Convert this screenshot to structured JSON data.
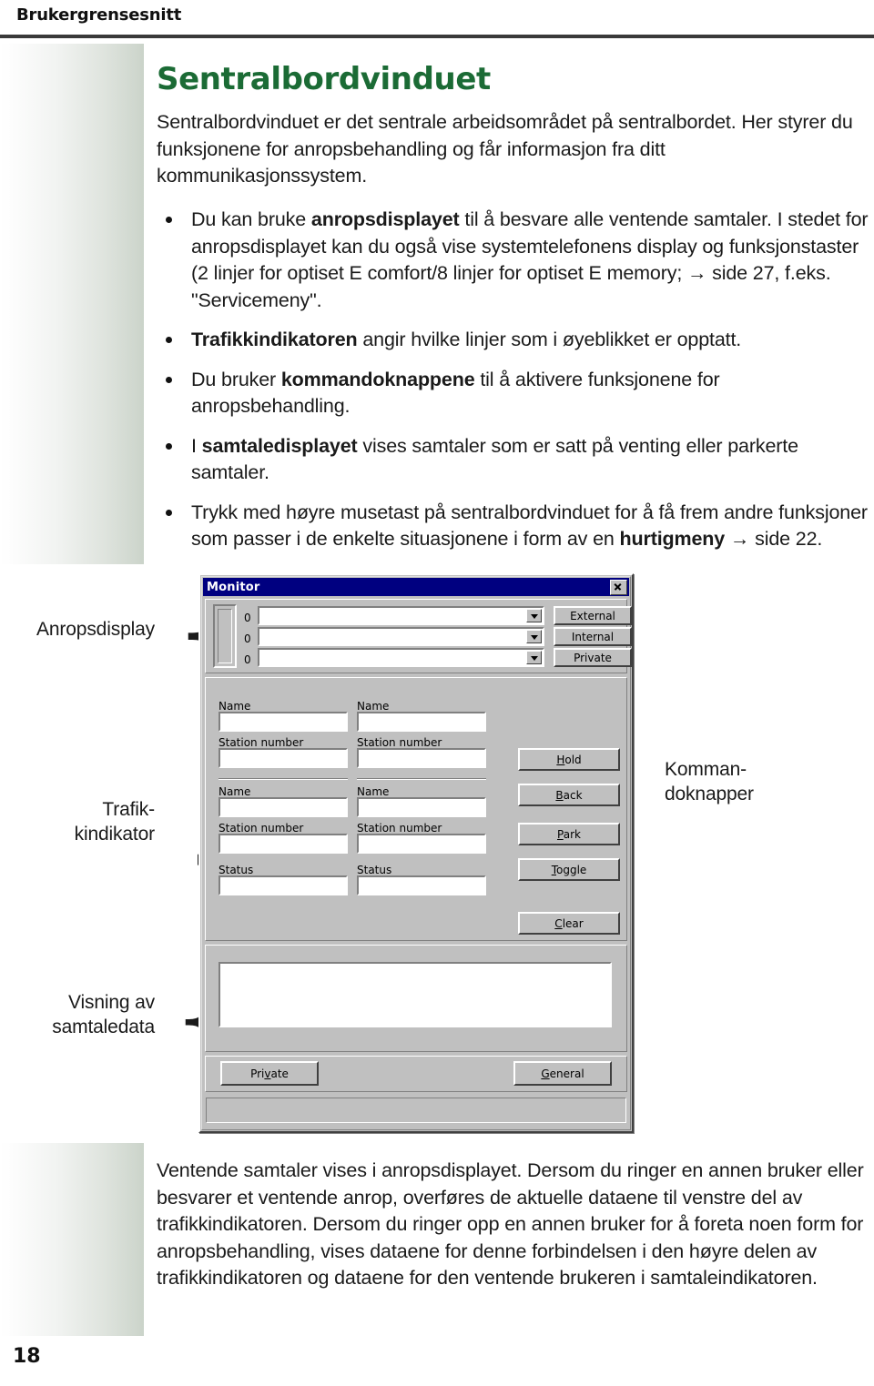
{
  "header": {
    "running_title": "Brukergrensesnitt"
  },
  "page": {
    "number": "18",
    "title": "Sentralbordvinduet",
    "intro": "Sentralbordvinduet er det sentrale arbeidsområdet på sentralbordet. Her styrer du funksjonene for anropsbehandling og får informasjon fra ditt kommunikasjonssystem.",
    "bullets": [
      {
        "segments": [
          {
            "text": "Du kan bruke ",
            "bold": false
          },
          {
            "text": "anropsdisplayet",
            "bold": true
          },
          {
            "text": " til å besvare alle ventende samtaler. I stedet for anropsdisplayet kan du også vise systemtelefonens display og funksjonstaster (2 linjer for optiset E comfort/8 linjer for optiset E memory; → side 27, f.eks. \"Servicemeny\".",
            "bold": false
          }
        ]
      },
      {
        "segments": [
          {
            "text": "Trafikkindikatoren",
            "bold": true
          },
          {
            "text": " angir hvilke linjer som i øyeblikket er opptatt.",
            "bold": false
          }
        ]
      },
      {
        "segments": [
          {
            "text": "Du bruker ",
            "bold": false
          },
          {
            "text": "kommandoknappene",
            "bold": true
          },
          {
            "text": " til å aktivere funksjonene for anropsbehandling.",
            "bold": false
          }
        ]
      },
      {
        "segments": [
          {
            "text": "I ",
            "bold": false
          },
          {
            "text": "samtaledisplayet",
            "bold": true
          },
          {
            "text": " vises samtaler som er satt på venting eller parkerte samtaler.",
            "bold": false
          }
        ]
      },
      {
        "segments": [
          {
            "text": "Trykk med høyre musetast på sentralbordvinduet for å få frem andre funksjoner som passer i de enkelte situasjonene i form av en ",
            "bold": false
          },
          {
            "text": "hurtigmeny",
            "bold": true
          },
          {
            "text": " → side 22.",
            "bold": false
          }
        ]
      }
    ],
    "closing": "Ventende samtaler vises i anropsdisplayet. Dersom du ringer en annen bruker eller besvarer et ventende anrop, overføres de aktuelle dataene til venstre del av trafikkindikatoren. Dersom du ringer opp en annen bruker for å foreta noen form for anropsbehandling, vises dataene for denne forbindelsen i den høyre delen av trafikkindikatoren og dataene for den ventende brukeren i samtaleindikatoren."
  },
  "annotations": {
    "anropsdisplay": "Anropsdisplay",
    "trafikkindikator_line1": "Trafik-",
    "trafikkindikator_line2": "kindikator",
    "kommandoknapper_line1": "Komman-",
    "kommandoknapper_line2": "doknapper",
    "samtaledata_line1": "Visning av",
    "samtaledata_line2": "samtaledata",
    "brace_glyph": "{",
    "brace_glyph_right": "}"
  },
  "dialog": {
    "title": "Monitor",
    "close_label": "×",
    "call_display": {
      "rows": [
        {
          "count": "0",
          "value": "",
          "button": "External"
        },
        {
          "count": "0",
          "value": "",
          "button": "Internal"
        },
        {
          "count": "0",
          "value": "",
          "button": "Private"
        }
      ]
    },
    "traffic_indicator": {
      "left_column": {
        "name_label_1": "Name",
        "name_value_1": "",
        "station_label_1": "Station number",
        "station_value_1": "",
        "name_label_2": "Name",
        "name_value_2": "",
        "station_label_2": "Station number",
        "station_value_2": "",
        "status_label": "Status",
        "status_value": ""
      },
      "right_column": {
        "name_label_1": "Name",
        "name_value_1": "",
        "station_label_1": "Station number",
        "station_value_1": "",
        "name_label_2": "Name",
        "name_value_2": "",
        "station_label_2": "Station number",
        "station_value_2": "",
        "status_label": "Status",
        "status_value": ""
      }
    },
    "command_buttons": [
      {
        "label": "Hold",
        "mnemonic": "H",
        "rest": "old"
      },
      {
        "label": "Back",
        "mnemonic": "B",
        "rest": "ack"
      },
      {
        "label": "Park",
        "mnemonic": "P",
        "rest": "ark"
      },
      {
        "label": "Toggle",
        "mnemonic": "T",
        "rest": "oggle"
      },
      {
        "label": "Clear",
        "mnemonic": "C",
        "rest": "lear"
      }
    ],
    "call_data_value": "",
    "footer_buttons": [
      {
        "label": "Private",
        "pre": "Pri",
        "mnemonic": "v",
        "rest": "ate"
      },
      {
        "label": "General",
        "mnemonic": "G",
        "rest": "eneral"
      }
    ],
    "statusbar_text": ""
  },
  "colors": {
    "title_green": "#1b6b35",
    "titlebar_blue": "#000080",
    "dialog_face": "#c0c0c0",
    "rule_dark": "#3a3a3a"
  }
}
